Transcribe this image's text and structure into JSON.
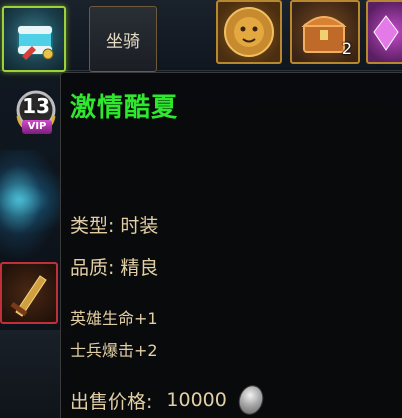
{
  "top_bar": {
    "mount_button_label": "坐骑",
    "chest_count": "2"
  },
  "vip_badge": {
    "level": "13",
    "label": "VIP"
  },
  "tooltip": {
    "item_name": "激情酷夏",
    "type_label": "类型:",
    "type_value": "时装",
    "quality_label": "品质:",
    "quality_value": "精良",
    "stats": [
      "英雄生命+1",
      "士兵爆击+2"
    ],
    "price_label": "出售价格:",
    "price_value": "10000",
    "currency_icon": "silver-coin-icon"
  },
  "colors": {
    "item_name_green": "#2ee82e",
    "tooltip_text": "#e3cfa4",
    "selected_slot_border": "#9bd23a",
    "gold_border": "#b8872e"
  }
}
